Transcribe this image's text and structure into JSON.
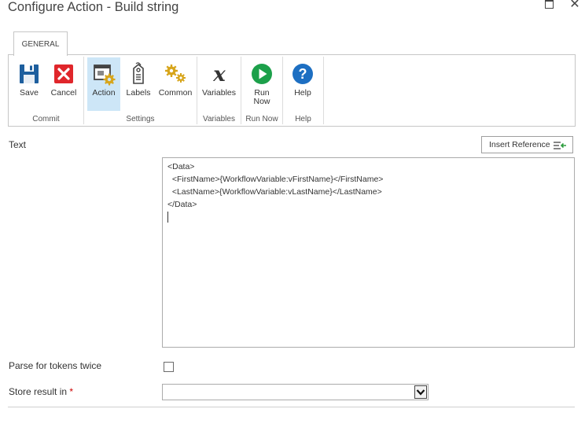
{
  "window": {
    "title": "Configure Action - Build string"
  },
  "ribbon": {
    "tab": "GENERAL",
    "buttons": {
      "save": "Save",
      "cancel": "Cancel",
      "action": "Action",
      "labels": "Labels",
      "common": "Common",
      "variables": "Variables",
      "run_now_1": "Run",
      "run_now_2": "Now",
      "help": "Help"
    },
    "groups": {
      "commit": "Commit",
      "settings": "Settings",
      "variables": "Variables",
      "run_now": "Run Now",
      "help": "Help"
    },
    "selected_button": "Action"
  },
  "form": {
    "text_label": "Text",
    "insert_reference": "Insert Reference",
    "text_lines": [
      "<Data>",
      "  <FirstName>{WorkflowVariable:vFirstName}</FirstName>",
      "  <LastName>{WorkflowVariable:vLastName}</LastName>",
      "</Data>"
    ],
    "parse_label": "Parse for tokens twice",
    "parse_checked": false,
    "store_label": "Store result in",
    "required_mark": "*",
    "store_value": ""
  },
  "colors": {
    "save": "#1e5f9e",
    "cancel": "#e0262b",
    "run": "#1ca04a",
    "help": "#1d6fc2",
    "gear": "#d7a51b",
    "selected": "#cde6f7",
    "insert_arrow": "#2e9d3f"
  }
}
